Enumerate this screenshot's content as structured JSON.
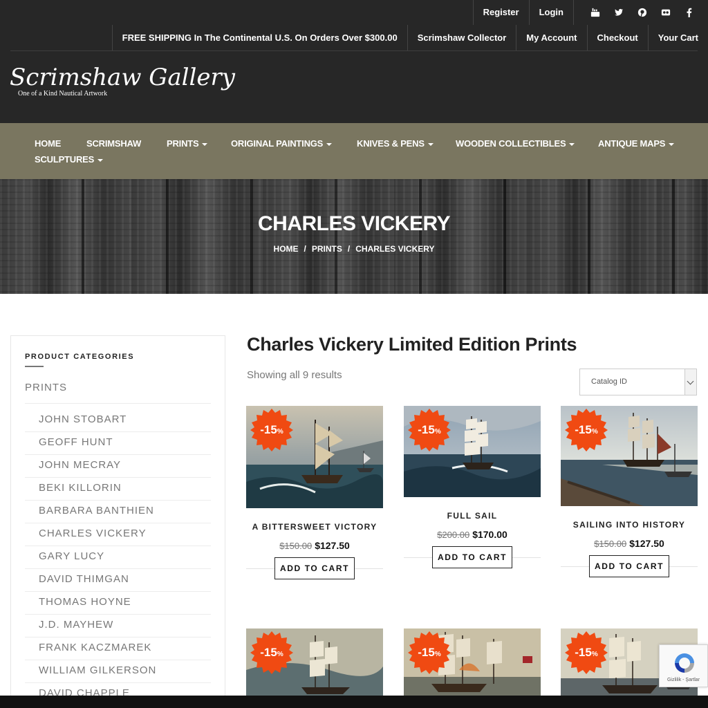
{
  "top_links": {
    "register": "Register",
    "login": "Login"
  },
  "social_icons": [
    "youtube-icon",
    "twitter-icon",
    "pinterest-icon",
    "flickr-icon",
    "facebook-icon"
  ],
  "secondary_bar": {
    "shipping": "FREE SHIPPING In The Continental U.S. On Orders Over $300.00",
    "collector": "Scrimshaw Collector",
    "account": "My Account",
    "checkout": "Checkout",
    "cart": "Your Cart"
  },
  "logo": {
    "name": "Scrimshaw Gallery",
    "tagline": "One of a Kind Nautical Artwork"
  },
  "main_nav": {
    "home": "HOME",
    "scrimshaw": "SCRIMSHAW",
    "prints": "PRINTS",
    "original_paintings": "ORIGINAL PAINTINGS",
    "knives_pens": "KNIVES & PENS",
    "wooden_collectibles": "WOODEN COLLECTIBLES",
    "antique_maps": "ANTIQUE MAPS",
    "sculptures": "SCULPTURES"
  },
  "hero": {
    "title": "CHARLES VICKERY",
    "breadcrumb": [
      "HOME",
      "PRINTS",
      "CHARLES VICKERY"
    ],
    "separator": "/"
  },
  "sidebar": {
    "heading": "PRODUCT CATEGORIES",
    "parent": "PRINTS",
    "items": [
      "JOHN STOBART",
      "GEOFF HUNT",
      "JOHN MECRAY",
      "BEKI KILLORIN",
      "BARBARA BANTHIEN",
      "CHARLES VICKERY",
      "GARY LUCY",
      "DAVID THIMGAN",
      "THOMAS HOYNE",
      "J.D. MAYHEW",
      "FRANK KACZMAREK",
      "WILLIAM GILKERSON",
      "DAVID CHAPPLE"
    ]
  },
  "shop": {
    "title": "Charles Vickery Limited Edition Prints",
    "result_count": "Showing all 9 results",
    "sort_value": "Catalog ID",
    "add_to_cart": "ADD TO CART",
    "products": [
      {
        "name": "A BITTERSWEET VICTORY",
        "old_price": "$150.00",
        "price": "$127.50",
        "discount": "-15",
        "discount_unit": "%"
      },
      {
        "name": "FULL SAIL",
        "old_price": "$200.00",
        "price": "$170.00",
        "discount": "-15",
        "discount_unit": "%"
      },
      {
        "name": "SAILING INTO HISTORY",
        "old_price": "$150.00",
        "price": "$127.50",
        "discount": "-15",
        "discount_unit": "%"
      },
      {
        "name": "",
        "old_price": "",
        "price": "",
        "discount": "-15",
        "discount_unit": "%"
      },
      {
        "name": "",
        "old_price": "",
        "price": "",
        "discount": "-15",
        "discount_unit": "%"
      },
      {
        "name": "",
        "old_price": "",
        "price": "",
        "discount": "-15",
        "discount_unit": "%"
      }
    ]
  },
  "recaptcha": {
    "text": "Gizlilik - Şartlar"
  },
  "colors": {
    "header_bg": "#272727",
    "nav_bg": "#7a7660",
    "badge": "#f04a12",
    "text_muted": "#777777"
  }
}
